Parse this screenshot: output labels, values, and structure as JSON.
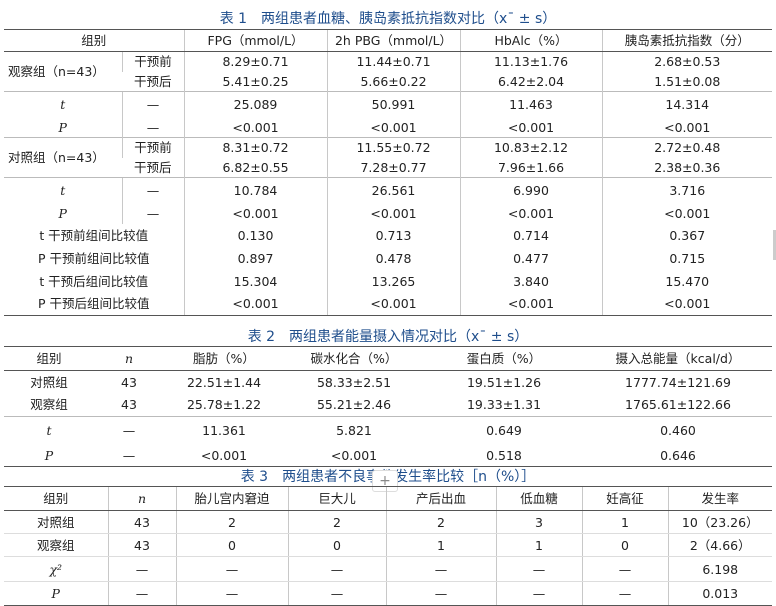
{
  "table1": {
    "caption": "表 1　两组患者血糖、胰岛素抵抗指数对比（x¯ ± s）",
    "headers": [
      "组别",
      "FPG（mmol/L）",
      "2h PBG（mmol/L）",
      "HbAlc（%）",
      "胰岛素抵抗指数（分）"
    ],
    "obs_group": "观察组（n=43）",
    "ctrl_group": "对照组（n=43）",
    "before": "干预前",
    "after": "干预后",
    "obs_before": [
      "8.29±0.71",
      "11.44±0.71",
      "11.13±1.76",
      "2.68±0.53"
    ],
    "obs_after": [
      "5.41±0.25",
      "5.66±0.22",
      "6.42±2.04",
      "1.51±0.08"
    ],
    "obs_t": [
      "25.089",
      "50.991",
      "11.463",
      "14.314"
    ],
    "obs_p": [
      "<0.001",
      "<0.001",
      "<0.001",
      "<0.001"
    ],
    "ctrl_before": [
      "8.31±0.72",
      "11.55±0.72",
      "10.83±2.12",
      "2.72±0.48"
    ],
    "ctrl_after": [
      "6.82±0.55",
      "7.28±0.77",
      "7.96±1.66",
      "2.38±0.36"
    ],
    "ctrl_t": [
      "10.784",
      "26.561",
      "6.990",
      "3.716"
    ],
    "ctrl_p": [
      "<0.001",
      "<0.001",
      "<0.001",
      "<0.001"
    ],
    "t_before_label": "t 干预前组间比较值",
    "t_before": [
      "0.130",
      "0.713",
      "0.714",
      "0.367"
    ],
    "p_before_label": "P 干预前组间比较值",
    "p_before": [
      "0.897",
      "0.478",
      "0.477",
      "0.715"
    ],
    "t_after_label": "t 干预后组间比较值",
    "t_after": [
      "15.304",
      "13.265",
      "3.840",
      "15.470"
    ],
    "p_after_label": "P 干预后组间比较值",
    "p_after": [
      "<0.001",
      "<0.001",
      "<0.001",
      "<0.001"
    ]
  },
  "table2": {
    "caption": "表 2　两组患者能量摄入情况对比（x¯ ± s）",
    "headers": [
      "组别",
      "n",
      "脂肪（%）",
      "碳水化合（%）",
      "蛋白质（%）",
      "摄入总能量（kcal/d）"
    ],
    "rows": [
      [
        "对照组",
        "43",
        "22.51±1.44",
        "58.33±2.51",
        "19.51±1.26",
        "1777.74±121.69"
      ],
      [
        "观察组",
        "43",
        "25.78±1.22",
        "55.21±2.46",
        "19.33±1.31",
        "1765.61±122.66"
      ]
    ],
    "t_row": [
      "t",
      "—",
      "11.361",
      "5.821",
      "0.649",
      "0.460"
    ],
    "p_row": [
      "P",
      "—",
      "<0.001",
      "<0.001",
      "0.518",
      "0.646"
    ]
  },
  "table3": {
    "caption": "表 3　两组患者不良事件发生率比较［n（%）］",
    "headers": [
      "组别",
      "n",
      "胎儿宫内窘迫",
      "巨大儿",
      "产后出血",
      "低血糖",
      "妊高征",
      "发生率"
    ],
    "rows": [
      [
        "对照组",
        "43",
        "2",
        "2",
        "2",
        "3",
        "1",
        "10（23.26）"
      ],
      [
        "观察组",
        "43",
        "0",
        "0",
        "1",
        "1",
        "0",
        "2（4.66）"
      ]
    ],
    "chi_row": [
      "χ²",
      "—",
      "—",
      "—",
      "—",
      "—",
      "—",
      "6.198"
    ],
    "p_row": [
      "P",
      "—",
      "—",
      "—",
      "—",
      "—",
      "—",
      "0.013"
    ]
  },
  "dash": "—",
  "t_symbol": "t",
  "p_symbol": "P",
  "plus_glyph": "+"
}
